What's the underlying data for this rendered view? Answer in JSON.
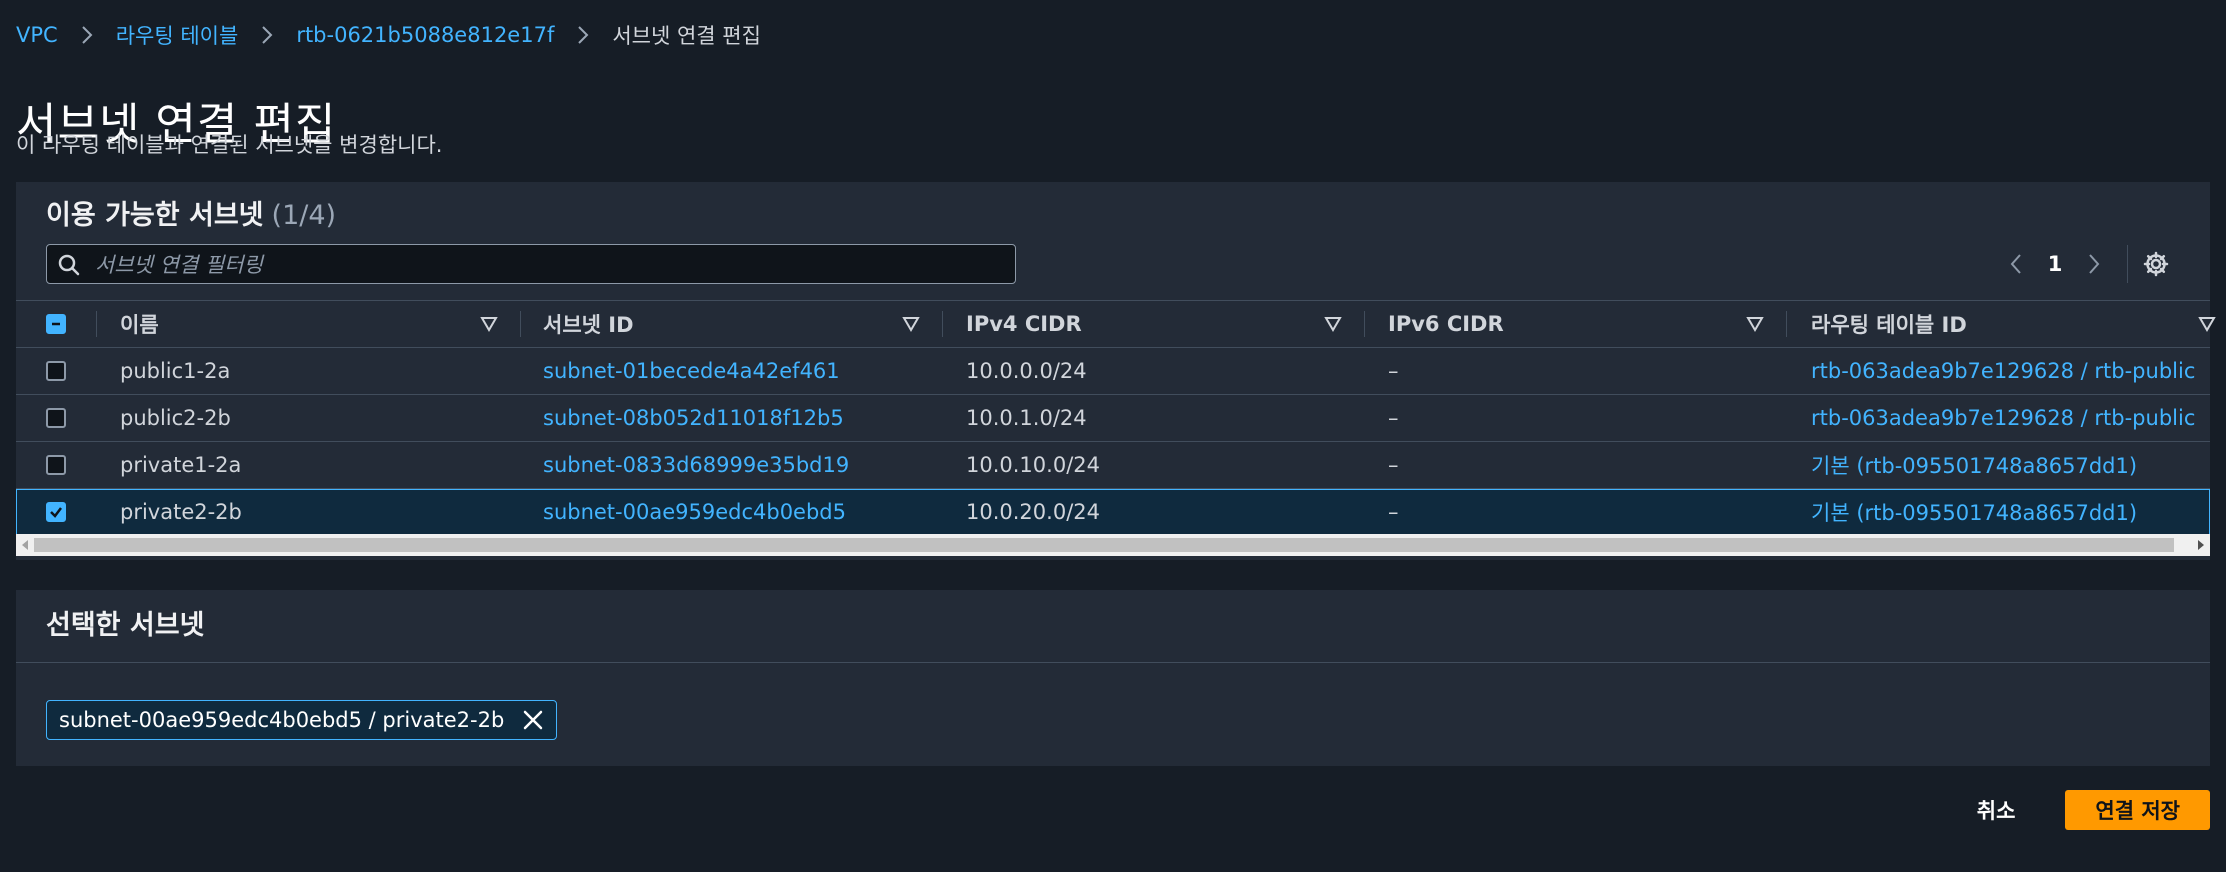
{
  "breadcrumb": {
    "items": [
      "VPC",
      "라우팅 테이블",
      "rtb-0621b5088e812e17f"
    ],
    "current": "서브넷 연결 편집"
  },
  "page": {
    "title": "서브넷 연결 편집",
    "description": "이 라우팅 테이블과 연결된 서브넷을 변경합니다."
  },
  "available": {
    "title": "이용 가능한 서브넷",
    "count": "(1/4)",
    "search_placeholder": "서브넷 연결 필터링",
    "page_number": "1",
    "columns": [
      "이름",
      "서브넷 ID",
      "IPv4 CIDR",
      "IPv6 CIDR",
      "라우팅 테이블 ID"
    ],
    "rows": [
      {
        "checked": false,
        "name": "public1-2a",
        "subnet_id": "subnet-01becede4a42ef461",
        "ipv4": "10.0.0.0/24",
        "ipv6": "–",
        "route_table": "rtb-063adea9b7e129628 / rtb-public"
      },
      {
        "checked": false,
        "name": "public2-2b",
        "subnet_id": "subnet-08b052d11018f12b5",
        "ipv4": "10.0.1.0/24",
        "ipv6": "–",
        "route_table": "rtb-063adea9b7e129628 / rtb-public"
      },
      {
        "checked": false,
        "name": "private1-2a",
        "subnet_id": "subnet-0833d68999e35bd19",
        "ipv4": "10.0.10.0/24",
        "ipv6": "–",
        "route_table": "기본 (rtb-095501748a8657dd1)"
      },
      {
        "checked": true,
        "name": "private2-2b",
        "subnet_id": "subnet-00ae959edc4b0ebd5",
        "ipv4": "10.0.20.0/24",
        "ipv6": "–",
        "route_table": "기본 (rtb-095501748a8657dd1)"
      }
    ]
  },
  "selected": {
    "title": "선택한 서브넷",
    "token_label": "subnet-00ae959edc4b0ebd5 / private2-2b"
  },
  "actions": {
    "cancel": "취소",
    "save": "연결 저장"
  },
  "colors": {
    "background": "#161d26",
    "panel": "#232b37",
    "link": "#42b4ff",
    "primary": "#ff9900"
  },
  "icons": [
    "chevron-right-icon",
    "search-icon",
    "chevron-left-icon",
    "gear-icon",
    "sort-down-icon",
    "close-icon",
    "checkmark-icon"
  ]
}
